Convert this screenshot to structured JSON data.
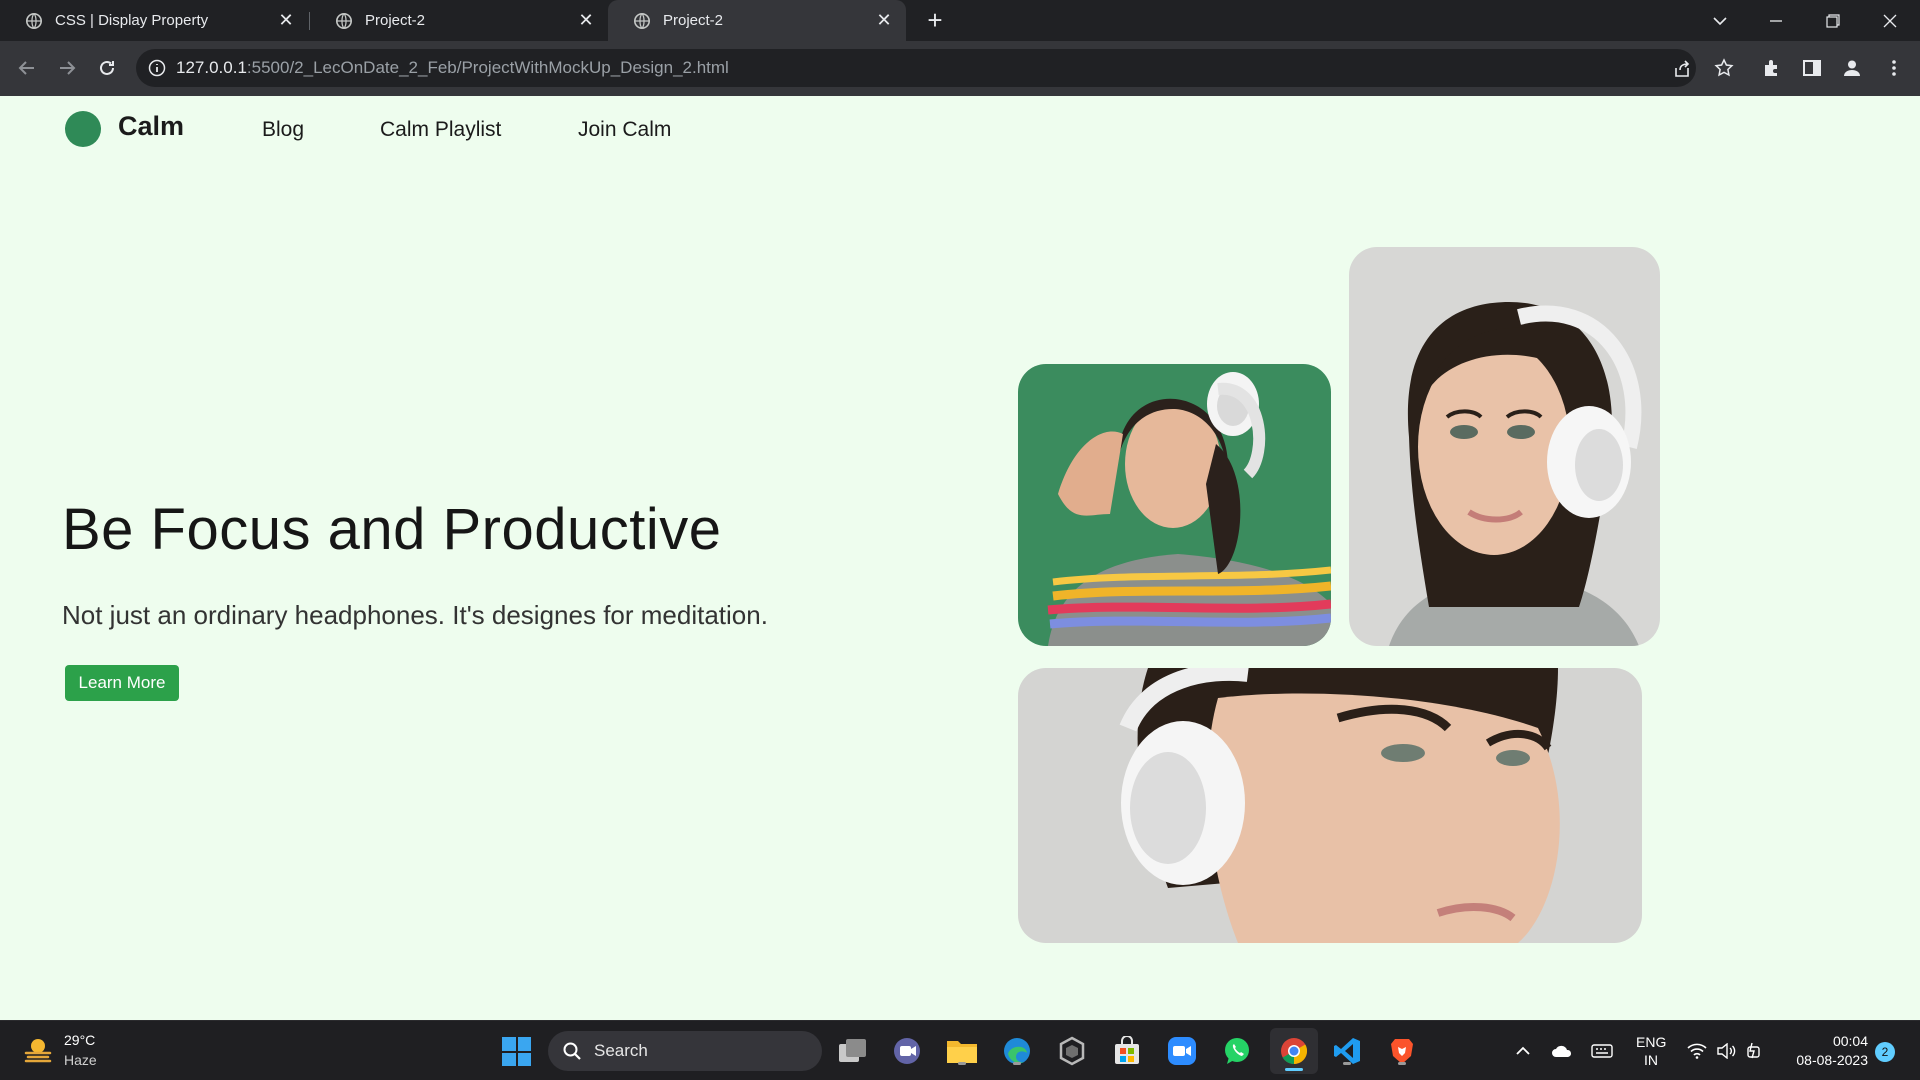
{
  "browser": {
    "tabs": [
      {
        "title": "CSS | Display Property"
      },
      {
        "title": "Project-2"
      },
      {
        "title": "Project-2"
      }
    ],
    "url_host": "127.0.0.1",
    "url_path": ":5500/2_LecOnDate_2_Feb/ProjectWithMockUp_Design_2.html"
  },
  "site": {
    "logo_text": "Calm",
    "nav": [
      "Blog",
      "Calm Playlist",
      "Join Calm"
    ],
    "hero_title": "Be Focus and Productive",
    "hero_subtitle": "Not just an ordinary headphones. It's designes for meditation.",
    "cta_label": "Learn More",
    "colors": {
      "background": "#eefdee",
      "accent": "#2ca14a",
      "logo": "#2f8a57"
    }
  },
  "taskbar": {
    "weather_temp": "29°C",
    "weather_desc": "Haze",
    "search_placeholder": "Search",
    "lang_primary": "ENG",
    "lang_secondary": "IN",
    "time": "00:04",
    "date": "08-08-2023",
    "notification_count": "2"
  }
}
